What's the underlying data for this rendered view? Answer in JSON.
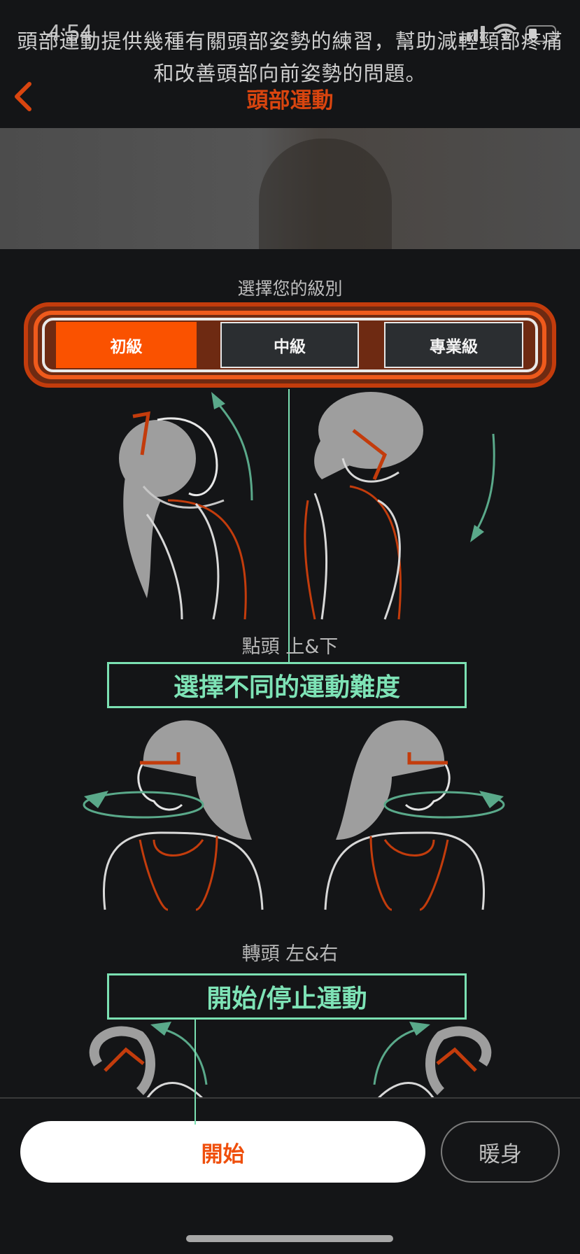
{
  "status": {
    "time": "4:54"
  },
  "header": {
    "title": "頭部運動"
  },
  "banner": {
    "text": "頭部運動提供幾種有關頭部姿勢的練習，幫助減輕頸部疼痛和改善頭部向前姿勢的問題。"
  },
  "level": {
    "label": "選擇您的級別",
    "options": [
      "初級",
      "中級",
      "專業級"
    ],
    "selected": "初級"
  },
  "exercises": [
    {
      "caption": "點頭 上&下"
    },
    {
      "caption": "轉頭 左&右"
    }
  ],
  "annotations": {
    "difficulty": "選擇不同的運動難度",
    "start_stop": "開始/停止運動"
  },
  "buttons": {
    "start": "開始",
    "warmup": "暖身"
  },
  "colors": {
    "accent": "#fa5200",
    "callout": "#7be0b2",
    "background": "#141517"
  }
}
